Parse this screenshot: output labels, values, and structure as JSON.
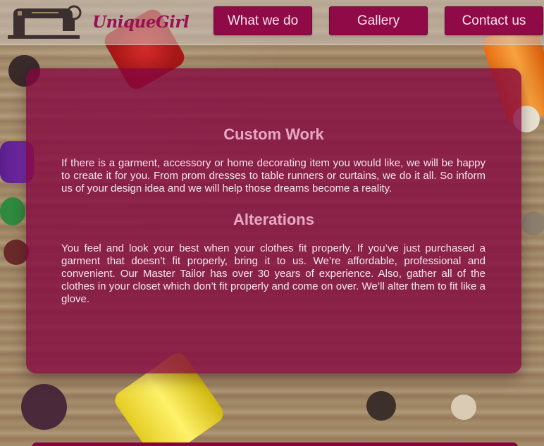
{
  "brand": {
    "name": "UniqueGirl",
    "logo_icon": "sewing-machine-icon"
  },
  "nav": {
    "items": [
      {
        "label": "What we do"
      },
      {
        "label": "Gallery"
      },
      {
        "label": "Contact us"
      }
    ]
  },
  "content": {
    "sections": [
      {
        "heading": "Custom Work",
        "body": "If there is a garment, accessory or home decorating item you would like, we will be happy to create it for you. From prom dresses to table runners or curtains, we do it all. So inform us of your design idea and we will help those dreams become a reality."
      },
      {
        "heading": "Alterations",
        "body": "You feel and look your best when your clothes fit properly. If you’ve just purchased a garment that doesn’t fit properly, bring it to us. We’re affordable, professional and convenient. Our Master Tailor has over 30 years of experience. Also, gather all of the clothes in your closet which don’t fit properly and come on over. We’ll alter them to fit like a glove."
      }
    ]
  },
  "colors": {
    "brand": "#9b0f55",
    "nav_button": "#8f0a46",
    "panel": "#84053f",
    "heading": "#e7a9c2",
    "background_wood": "#9f8765"
  },
  "background": {
    "description_icon": "buttons-and-thread-spools-background"
  }
}
